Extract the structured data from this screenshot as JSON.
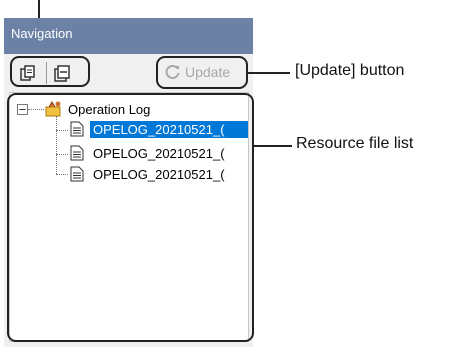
{
  "panel": {
    "title": "Navigation",
    "update_label": "Update"
  },
  "tree": {
    "root_label": "Operation Log",
    "items": [
      {
        "label": "OPELOG_20210521_(",
        "selected": true
      },
      {
        "label": "OPELOG_20210521_(",
        "selected": false
      },
      {
        "label": "OPELOG_20210521_(",
        "selected": false
      }
    ]
  },
  "annotations": {
    "update_button": "[Update] button",
    "resource_list": "Resource file list"
  },
  "colors": {
    "titlebar": "#6b82a6",
    "selection": "#0078d7",
    "disabled_text": "#a8a8a8"
  }
}
